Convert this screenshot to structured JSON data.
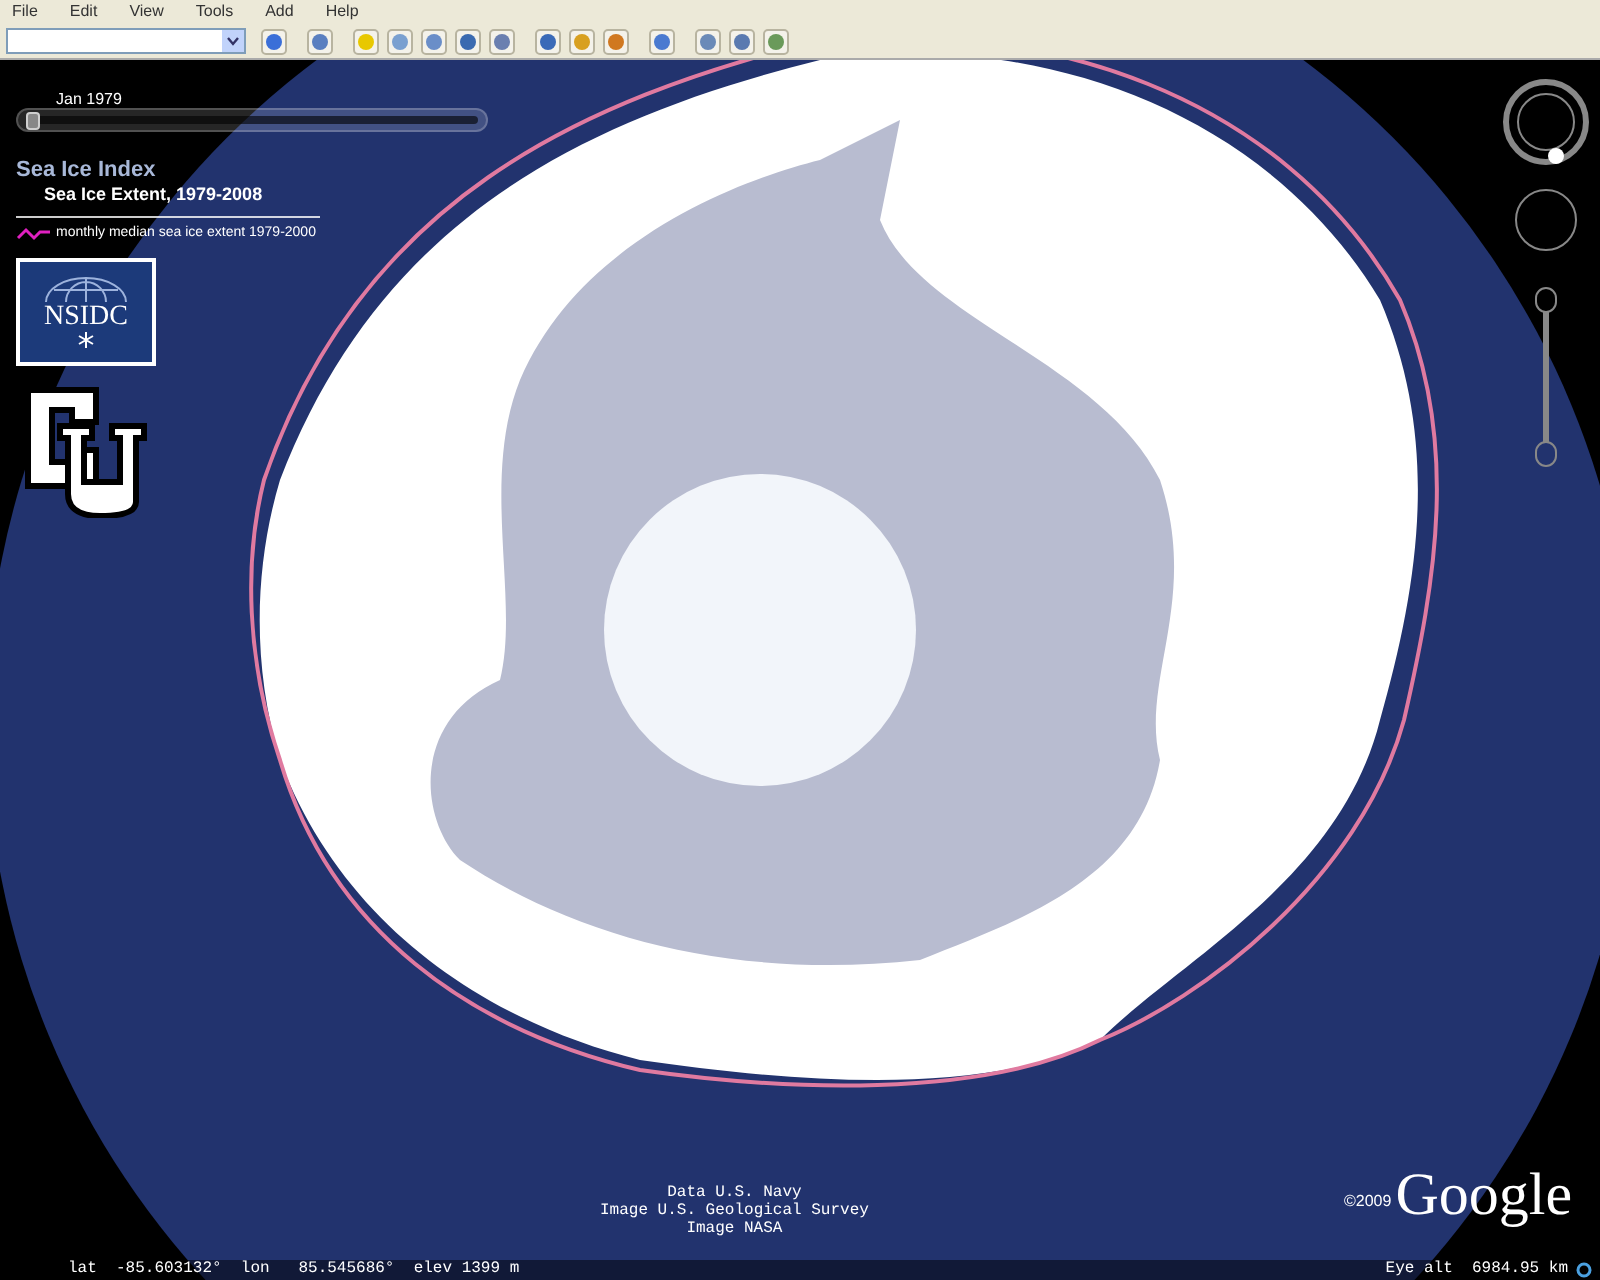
{
  "menu": [
    "File",
    "Edit",
    "View",
    "Tools",
    "Add",
    "Help"
  ],
  "time_slider": {
    "label": "Jan 1979",
    "level": 0
  },
  "legend": {
    "title": "Sea Ice Index",
    "subtitle": "Sea Ice Extent, 1979-2008",
    "line_label": "monthly median sea ice extent 1979-2000"
  },
  "logos": [
    {
      "text": "NSIDC"
    }
  ],
  "credits": [
    "Data U.S. Navy",
    "Image U.S. Geological Survey",
    "Image NASA"
  ],
  "copyright": "©2009",
  "brand": "Google",
  "status_bar": {
    "lat": "lat  -85.603132°  lon   85.545686°  elev 1399 m",
    "eye_alt": "Eye alt  6984.95 km"
  }
}
